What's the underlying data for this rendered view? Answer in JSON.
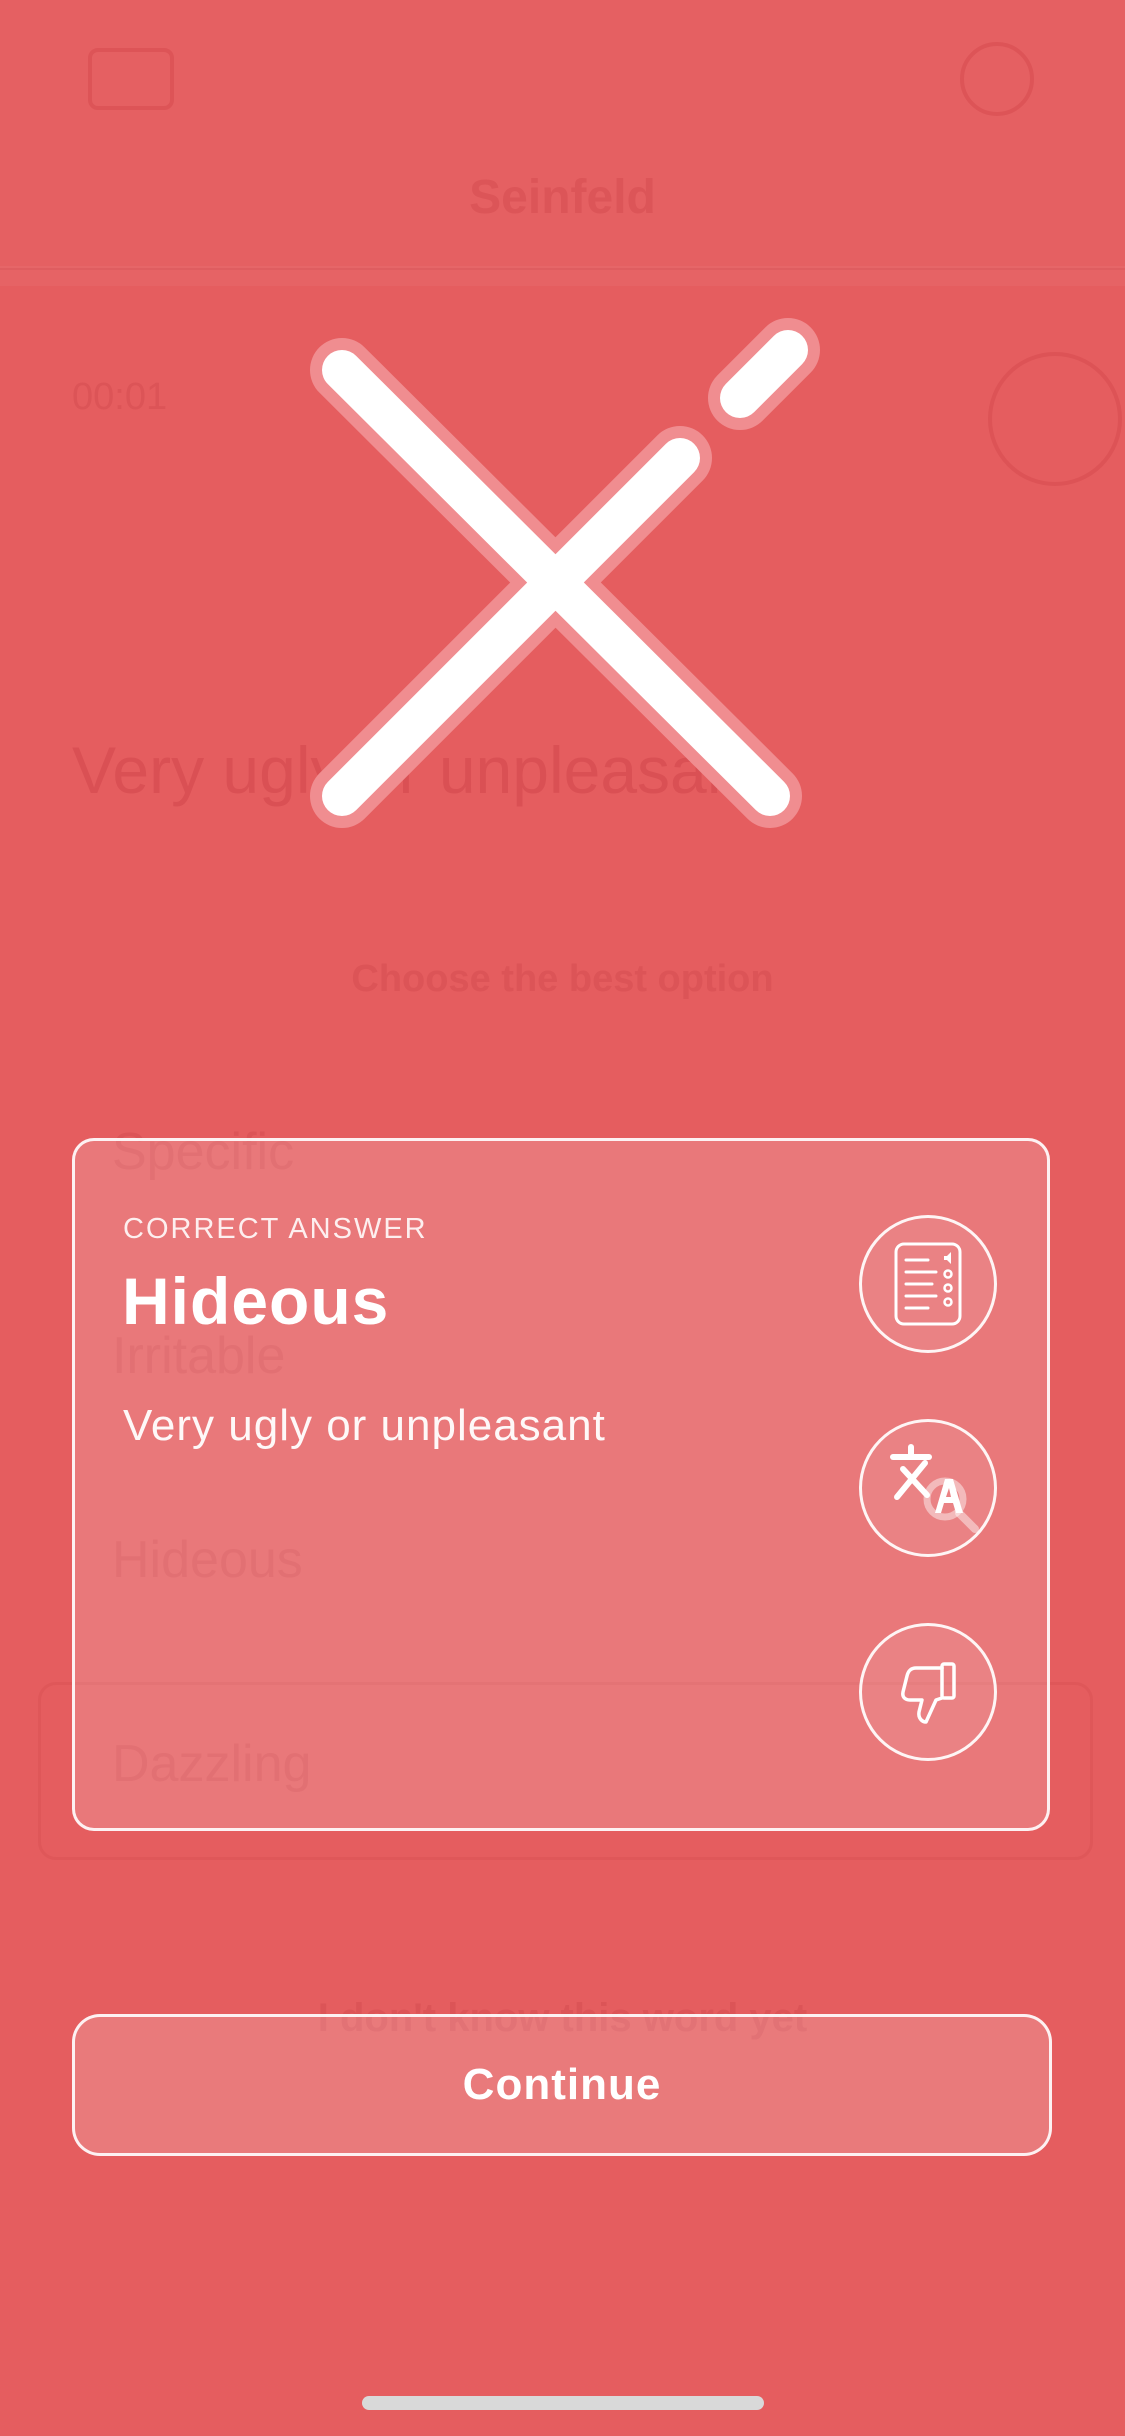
{
  "background_screen": {
    "title": "Seinfeld",
    "timer": "00:01",
    "question": "Very ugly or unpleasant",
    "instruction": "Choose the best option",
    "options": [
      "Specific",
      "Irritable",
      "Hideous",
      "Dazzling"
    ],
    "bottom_text": "I don't know this word yet"
  },
  "result": {
    "icon": "x-mark-icon"
  },
  "answer_card": {
    "caption": "CORRECT ANSWER",
    "word": "Hideous",
    "definition": "Very ugly or unpleasant",
    "actions": [
      {
        "icon": "dictionary-audio-icon"
      },
      {
        "icon": "translate-icon"
      },
      {
        "icon": "thumbs-down-icon"
      }
    ]
  },
  "continue_button": {
    "label": "Continue"
  },
  "colors": {
    "background": "#e55d5f",
    "card_fill": "rgba(255,255,255,0.17)",
    "foreground": "#ffffff"
  }
}
